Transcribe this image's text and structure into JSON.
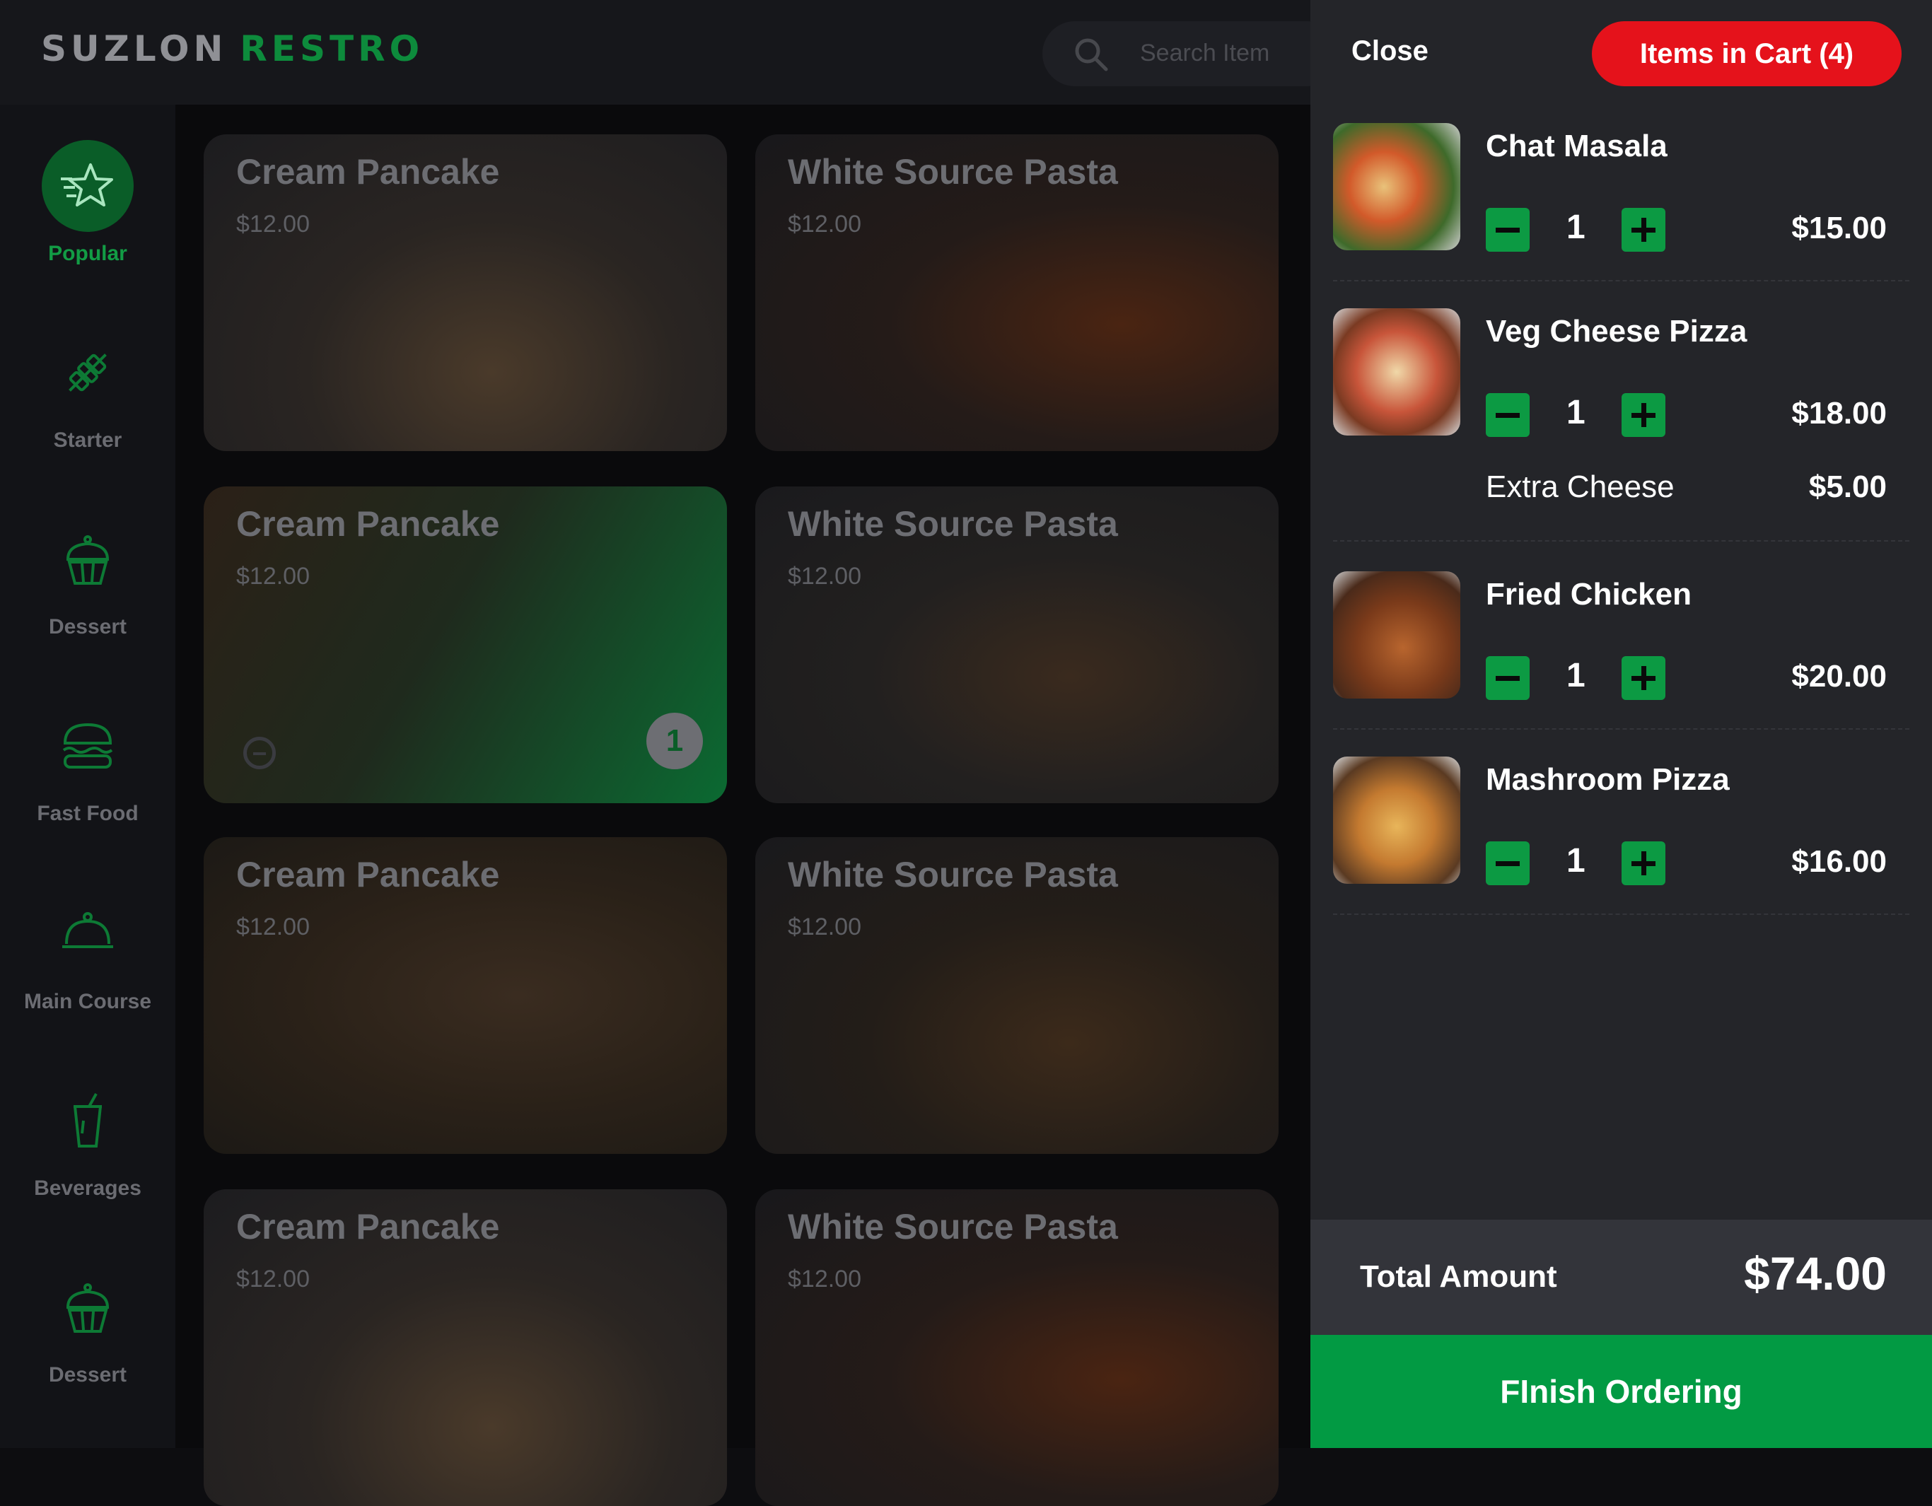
{
  "brand": {
    "part1": "SUZLON",
    "part2": "RESTRO"
  },
  "search": {
    "placeholder": "Search Item"
  },
  "categories": [
    {
      "label": "Popular",
      "icon": "star-icon",
      "active": true
    },
    {
      "label": "Starter",
      "icon": "skewer-icon"
    },
    {
      "label": "Dessert",
      "icon": "cupcake-icon"
    },
    {
      "label": "Fast Food",
      "icon": "burger-icon"
    },
    {
      "label": "Main Course",
      "icon": "cloche-icon"
    },
    {
      "label": "Beverages",
      "icon": "cup-icon"
    },
    {
      "label": "Dessert",
      "icon": "cupcake-icon"
    }
  ],
  "menu_items": [
    {
      "title": "Cream Pancake",
      "price": "$12.00"
    },
    {
      "title": "White Source Pasta",
      "price": "$12.00"
    },
    {
      "title": "Cream Pancake",
      "price": "$12.00",
      "quantity": "1",
      "selected": true
    },
    {
      "title": "White Source Pasta",
      "price": "$12.00"
    },
    {
      "title": "Cream Pancake",
      "price": "$12.00"
    },
    {
      "title": "White Source Pasta",
      "price": "$12.00"
    },
    {
      "title": "Cream Pancake",
      "price": "$12.00"
    },
    {
      "title": "White Source Pasta",
      "price": "$12.00"
    }
  ],
  "cart": {
    "close_label": "Close",
    "items_button": "Items in Cart (4)",
    "items": [
      {
        "name": "Chat Masala",
        "qty": "1",
        "price": "$15.00"
      },
      {
        "name": "Veg Cheese Pizza",
        "qty": "1",
        "price": "$18.00",
        "addon_name": "Extra Cheese",
        "addon_price": "$5.00"
      },
      {
        "name": "Fried Chicken",
        "qty": "1",
        "price": "$20.00"
      },
      {
        "name": "Mashroom Pizza",
        "qty": "1",
        "price": "$16.00"
      }
    ],
    "total_label": "Total Amount",
    "total_value": "$74.00",
    "finish_label": "FInish Ordering"
  },
  "colors": {
    "accent_green": "#029a43",
    "cart_red": "#e5121b",
    "panel": "#242529"
  }
}
